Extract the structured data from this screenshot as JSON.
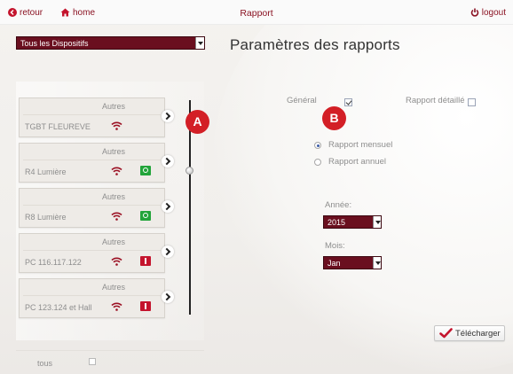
{
  "topbar": {
    "back_label": "retour",
    "home_label": "home",
    "title": "Rapport",
    "logout_label": "logout"
  },
  "device_filter": {
    "selected": "Tous les Dispositifs"
  },
  "main_title": "Paramètres des rapports",
  "devices": [
    {
      "category": "Autres",
      "name": "TGBT FLEUREVE",
      "status": "none"
    },
    {
      "category": "Autres",
      "name": "R4 Lumière",
      "status": "green"
    },
    {
      "category": "Autres",
      "name": "R8 Lumière",
      "status": "green"
    },
    {
      "category": "Autres",
      "name": "PC 116.117.122",
      "status": "red"
    },
    {
      "category": "Autres",
      "name": "PC 123.124 et Hall",
      "status": "red"
    }
  ],
  "callouts": {
    "a": "A",
    "b": "B"
  },
  "all_toggle": {
    "label": "tous",
    "checked": false
  },
  "options": {
    "general_label": "Général",
    "general_checked": true,
    "detailed_label": "Rapport détaillé",
    "detailed_checked": false,
    "monthly_label": "Rapport mensuel",
    "yearly_label": "Rapport annuel",
    "period_selected": "monthly"
  },
  "year": {
    "label": "Année:",
    "selected": "2015"
  },
  "month": {
    "label": "Mois:",
    "selected": "Jan"
  },
  "download_label": "Télécharger",
  "colors": {
    "accent": "#8a1222",
    "select_bg": "#6a0f1f",
    "callout": "#d31f26",
    "status_green": "#22a43a",
    "status_red": "#c4142d"
  }
}
